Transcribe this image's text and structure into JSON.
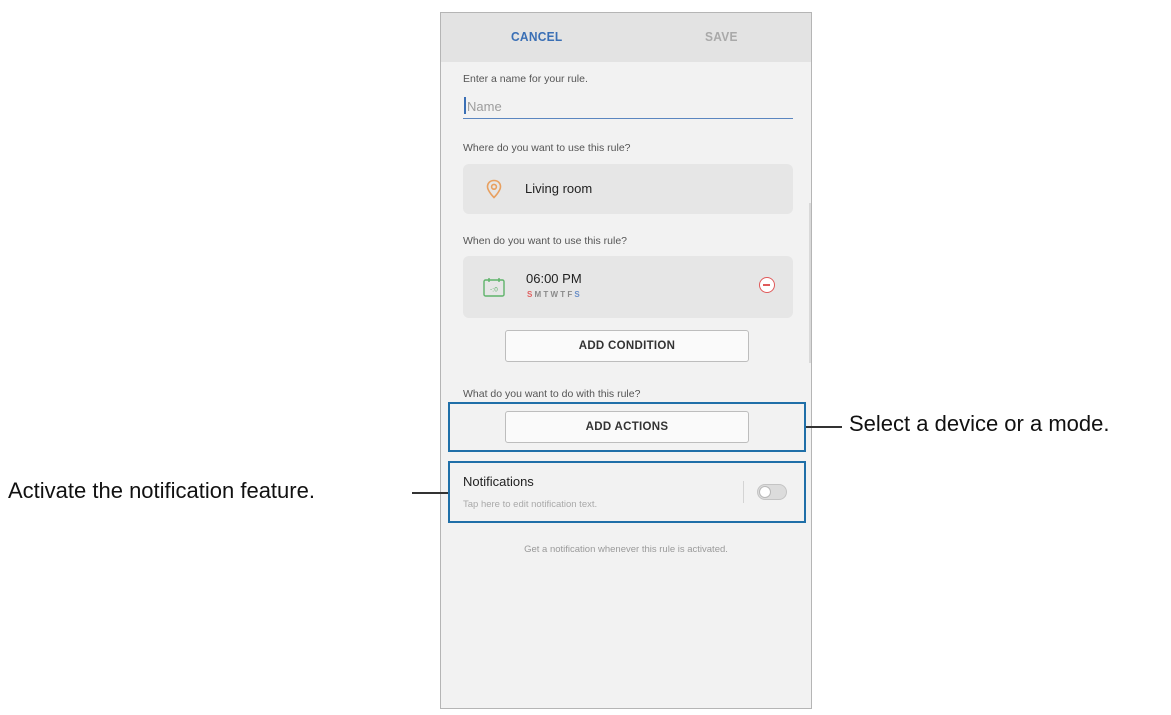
{
  "header": {
    "cancel_label": "CANCEL",
    "save_label": "SAVE"
  },
  "name_section": {
    "prompt": "Enter a name for your rule.",
    "placeholder": "Name"
  },
  "where_section": {
    "prompt": "Where do you want to use this rule?",
    "location": "Living room",
    "icon": "location-pin-icon"
  },
  "when_section": {
    "prompt": "When do you want to use this rule?",
    "time": "06:00 PM",
    "days": {
      "sun": "S",
      "week": "MTWTF",
      "sat": "S"
    },
    "icon": "calendar-icon",
    "remove_icon": "remove-icon"
  },
  "add_condition_label": "ADD CONDITION",
  "actions_section": {
    "prompt": "What do you want to do with this rule?",
    "add_actions_label": "ADD ACTIONS"
  },
  "notifications": {
    "title": "Notifications",
    "subtitle": "Tap here to edit notification text.",
    "enabled": false,
    "helper": "Get a notification whenever this rule is activated."
  },
  "callouts": {
    "actions": "Select a device or a mode.",
    "notifications": "Activate the notification feature."
  },
  "colors": {
    "accent": "#3a6fb5",
    "highlight_border": "#1f6fa8",
    "remove_red": "#e05a5a"
  }
}
